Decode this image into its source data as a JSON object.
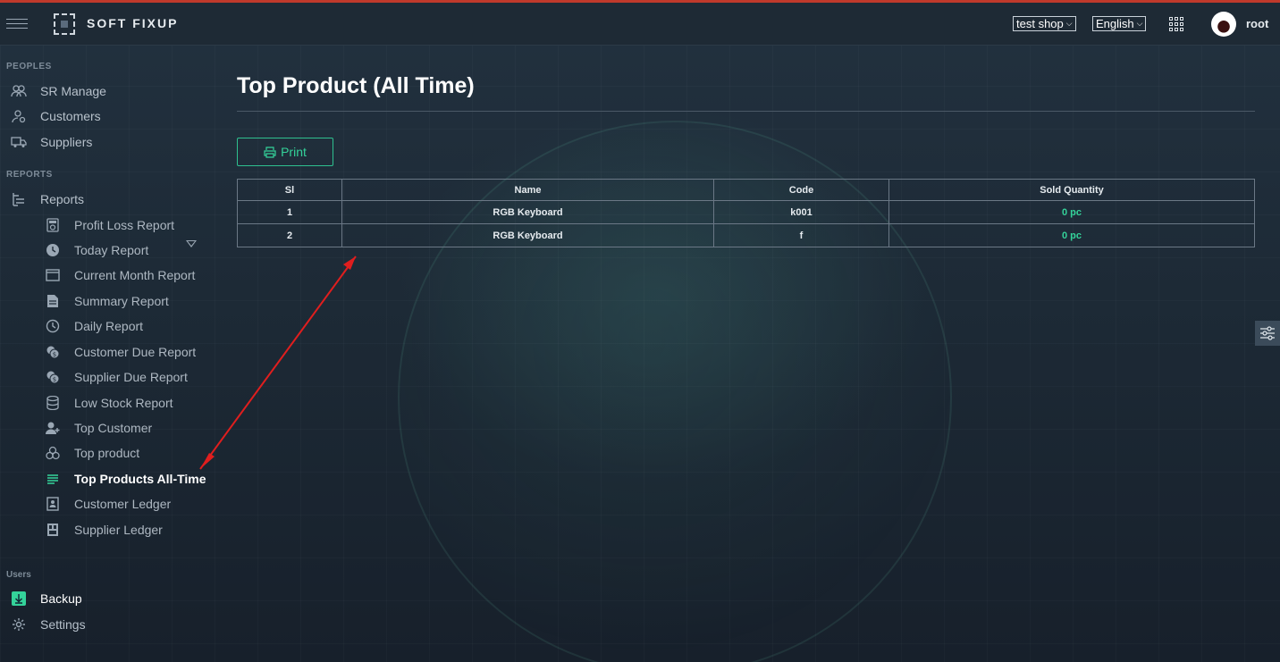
{
  "header": {
    "brand": "SOFT FIXUP",
    "shop_select": "test shop",
    "language_select": "English",
    "username": "root"
  },
  "sidebar": {
    "sections": {
      "peoples": "PEOPLES",
      "reports": "REPORTS",
      "users": "Users"
    },
    "peoples_items": [
      "SR Manage",
      "Customers",
      "Suppliers"
    ],
    "reports_label": "Reports",
    "report_items": [
      "Profit Loss Report",
      "Today Report",
      "Current Month Report",
      "Summary Report",
      "Daily Report",
      "Customer Due Report",
      "Supplier Due Report",
      "Low Stock Report",
      "Top Customer",
      "Top product",
      "Top Products All-Time",
      "Customer Ledger",
      "Supplier Ledger"
    ],
    "active_item": "Top Products All-Time",
    "users_items": [
      "Backup",
      "Settings"
    ]
  },
  "main": {
    "title": "Top Product (All Time)",
    "print_label": "Print",
    "table": {
      "headers": [
        "Sl",
        "Name",
        "Code",
        "Sold Quantity"
      ],
      "rows": [
        [
          "1",
          "RGB Keyboard",
          "k001",
          "0 pc"
        ],
        [
          "2",
          "RGB Keyboard",
          "f",
          "0 pc"
        ]
      ]
    }
  },
  "colors": {
    "accent": "#34d39a",
    "annotation_arrow": "#e01e1e",
    "top_bar": "#c0392b"
  }
}
